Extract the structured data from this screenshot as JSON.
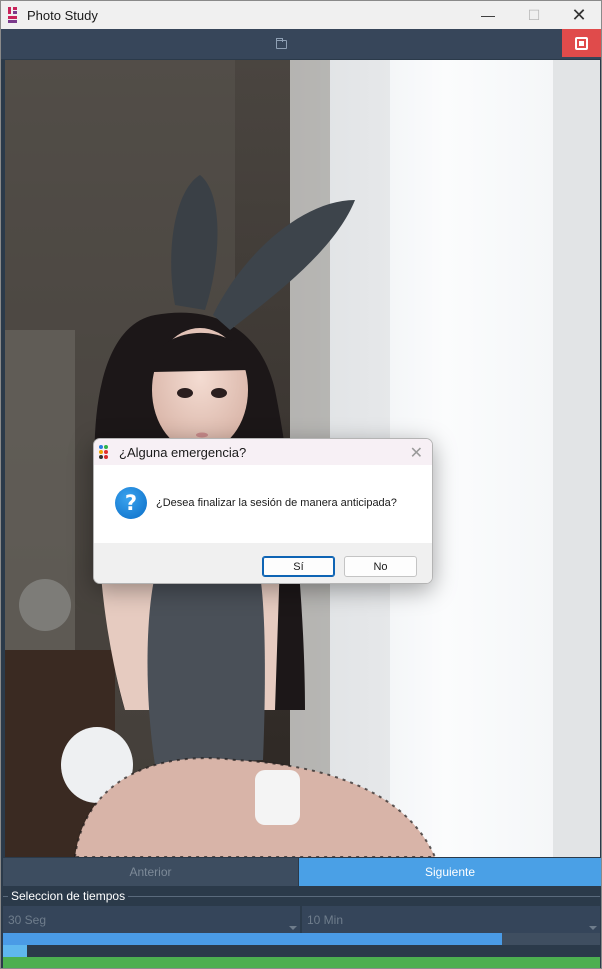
{
  "window": {
    "title": "Photo Study",
    "minimize_glyph": "—",
    "maximize_glyph": "☐",
    "close_glyph": "✕"
  },
  "toolbar": {
    "folder_icon": "folder-icon",
    "stop_icon": "stop-icon",
    "stop_color": "#e04b4b"
  },
  "navigation": {
    "prev_label": "Anterior",
    "next_label": "Siguiente",
    "next_color": "#4aa0e6"
  },
  "time_selection": {
    "legend": "Seleccion de tiempos",
    "interval_value": "30 Seg",
    "total_value": "10 Min"
  },
  "progress": {
    "session_fraction": 0.836,
    "interval_fraction": 0.04,
    "total_fraction": 1.0,
    "session_color": "#4a9be6",
    "interval_color": "#5fb8ee",
    "total_color": "#4caf50"
  },
  "dialog": {
    "title": "¿Alguna emergencia?",
    "close_glyph": "✕",
    "icon": "question-icon",
    "icon_glyph": "?",
    "message": "¿Desea finalizar la sesión de manera anticipada?",
    "yes_label": "Sí",
    "no_label": "No"
  }
}
